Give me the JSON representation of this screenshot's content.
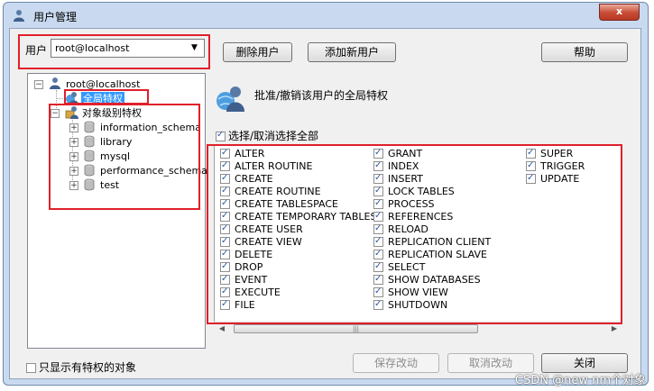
{
  "window": {
    "title": "用户管理",
    "close_label": "x"
  },
  "user": {
    "label": "用户",
    "selected": "root@localhost"
  },
  "buttons": {
    "delete_user": "删除用户",
    "add_user": "添加新用户",
    "help": "帮助",
    "save": "保存改动",
    "cancel": "取消改动",
    "close": "关闭"
  },
  "tree": {
    "root": "root@localhost",
    "global": "全局特权",
    "object_level": "对象级别特权",
    "schemas": [
      "information_schema",
      "library",
      "mysql",
      "performance_schema",
      "test"
    ]
  },
  "header_text": "批准/撤销该用户的全局特权",
  "select_all_label": "选择/取消选择全部",
  "privileges": {
    "col1": [
      "ALTER",
      "ALTER ROUTINE",
      "CREATE",
      "CREATE ROUTINE",
      "CREATE TABLESPACE",
      "CREATE TEMPORARY TABLES",
      "CREATE USER",
      "CREATE VIEW",
      "DELETE",
      "DROP",
      "EVENT",
      "EXECUTE",
      "FILE"
    ],
    "col2": [
      "GRANT",
      "INDEX",
      "INSERT",
      "LOCK TABLES",
      "PROCESS",
      "REFERENCES",
      "RELOAD",
      "REPLICATION CLIENT",
      "REPLICATION SLAVE",
      "SELECT",
      "SHOW DATABASES",
      "SHOW VIEW",
      "SHUTDOWN"
    ],
    "col3": [
      "SUPER",
      "TRIGGER",
      "UPDATE"
    ]
  },
  "only_privileged_label": "只显示有特权的对象",
  "watermark": "CSDN @new nm个对象",
  "icons": [
    "user-icon",
    "globe-user-icon",
    "object-privilege-icon",
    "database-icon",
    "checkbox-checked-icon"
  ],
  "colors": {
    "highlight_box": "#e0202a",
    "selection": "#3399ff"
  }
}
